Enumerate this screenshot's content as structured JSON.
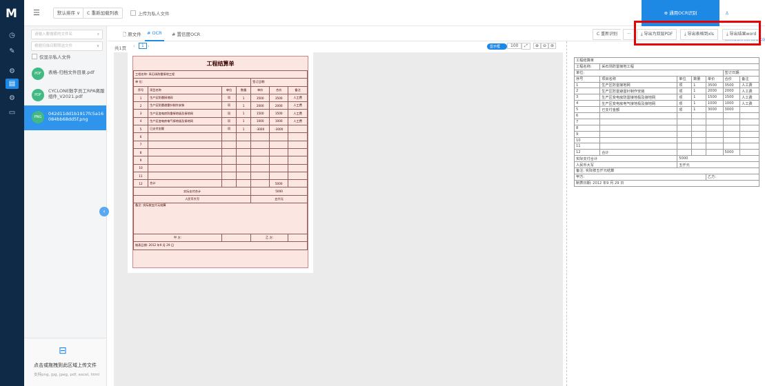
{
  "app": {
    "logo": "M",
    "ocr_button": "⊕ 通用OCR识别",
    "user": "♙ ixinwu@ixinwu.com"
  },
  "toolbar": {
    "sort": "默认排序 ∨",
    "refresh": "C 重新加载列表",
    "upload_private": "上传为私人文件"
  },
  "sidebar": {
    "search_placeholder": "请输入要搜索的文件名",
    "filter_placeholder": "根据扫描日期筛选文件",
    "private_only": "仅显示私人文件",
    "files": [
      {
        "name": "表格-归档文件目录.pdf",
        "icon": "PDF"
      },
      {
        "name": "CYCLONE数字员工RPA离服组件_V2021.pdf",
        "icon": "PDF"
      },
      {
        "name": "042d11dd1b1917fc5a16084bb68dd5f.png",
        "icon": "PNG"
      }
    ],
    "upload_title": "点击或拖拽到此区域上传文件",
    "upload_hint": "支持png, jpg, jpeg, pdf, excel, html"
  },
  "tabs": [
    {
      "label": "原文件"
    },
    {
      "label": "OCR"
    },
    {
      "label": "置信度OCR"
    }
  ],
  "pager": {
    "label": "共1页",
    "page": "1"
  },
  "viewer_controls": {
    "toggle": "显示框",
    "zoom": "100"
  },
  "right_toolbar": {
    "rerecognize": "C 重新识别",
    "more": "···",
    "export_pdf": "⤓ 导出为双层PDF",
    "export_xls": "⤓ 导出表格到xls",
    "export_word": "⤓ 导出结果word"
  },
  "document": {
    "title": "工程结算单",
    "project_label": "工程名称:",
    "project_name": "采石场防雷接地工程",
    "unit_label": "单 位:",
    "date_label": "签订日期:",
    "headers": [
      "序号",
      "项目名称",
      "单位",
      "数量",
      "单价",
      "合价",
      "备注"
    ],
    "rows": [
      [
        "1",
        "生产区防雷接地网",
        "项",
        "1",
        "3500",
        "3500",
        "人工费"
      ],
      [
        "2",
        "生产区防雷避雷针制作安装",
        "项",
        "1",
        "2000",
        "2000",
        "人工费"
      ],
      [
        "3",
        "生产区变电房防雷接地极及接地网",
        "项",
        "1",
        "1500",
        "1500",
        "人工费"
      ],
      [
        "4",
        "生产区变电房电气接地极及接地网",
        "项",
        "1",
        "1000",
        "1000",
        "人工费"
      ],
      [
        "5",
        "已支付金额",
        "项",
        "1",
        "-3000",
        "-3000",
        ""
      ],
      [
        "6",
        "",
        "",
        "",
        "",
        "",
        ""
      ],
      [
        "7",
        "",
        "",
        "",
        "",
        "",
        ""
      ],
      [
        "8",
        "",
        "",
        "",
        "",
        "",
        ""
      ],
      [
        "9",
        "",
        "",
        "",
        "",
        "",
        ""
      ],
      [
        "10",
        "",
        "",
        "",
        "",
        "",
        ""
      ],
      [
        "11",
        "",
        "",
        "",
        "",
        "",
        ""
      ],
      [
        "12",
        "合计",
        "",
        "",
        "",
        "5000",
        ""
      ]
    ],
    "actual_label": "实际支付合计",
    "actual_value": "5000",
    "rmb_label": "人民币大写",
    "rmb_value": "五仟元",
    "note": "备注: 实际按五仟元结算",
    "party_a": "甲 方:",
    "party_b": "乙 方:",
    "made_date": "制表日期: 2012 年9 月 29 日"
  },
  "ocr_result": {
    "title": "工程结算单",
    "project_label": "工程名称:",
    "project_name": "采石场防雷接地工程",
    "unit_label": "单位:",
    "date_label": "签订日期:",
    "headers": [
      "序号",
      "项目名称",
      "单位",
      "数量",
      "单价",
      "合价",
      "备注"
    ],
    "rows": [
      [
        "1",
        "生产区防雷接地网",
        "项",
        "1",
        "3500",
        "3500",
        "人工费"
      ],
      [
        "2",
        "生产区防雷避雷针制作安装",
        "项",
        "1",
        "2000",
        "2000",
        "人工费"
      ],
      [
        "3",
        "生产区变电房防雷接地极及接地网",
        "项",
        "1",
        "1500",
        "1500",
        "人工费"
      ],
      [
        "4",
        "生产区变电房电气接地极及接地网",
        "项",
        "1",
        "1000",
        "1000",
        "人工费"
      ],
      [
        "5",
        "已支付金额",
        "项",
        "1",
        "3000",
        "3000",
        ""
      ],
      [
        "6",
        "",
        "",
        "",
        "",
        "",
        ""
      ],
      [
        "7",
        "",
        "",
        "",
        "",
        "",
        ""
      ],
      [
        "8",
        "",
        "",
        "",
        "",
        "",
        ""
      ],
      [
        "9",
        "",
        "",
        "",
        "",
        "",
        ""
      ],
      [
        "10",
        "",
        "",
        "",
        "",
        "",
        ""
      ],
      [
        "11",
        "",
        "",
        "",
        "",
        "",
        ""
      ],
      [
        "12",
        "合计",
        "",
        "",
        "",
        "5000",
        ""
      ]
    ],
    "actual_label": "实际支付合计",
    "actual_value": "5000",
    "rmb_label": "人民币大写",
    "rmb_value": "五仟元",
    "note": "备注: 实际按五仟元结算",
    "party_a": "甲方:",
    "party_b": "乙方:",
    "made_date": "制表日期: 2012 年9 月 29 日"
  }
}
